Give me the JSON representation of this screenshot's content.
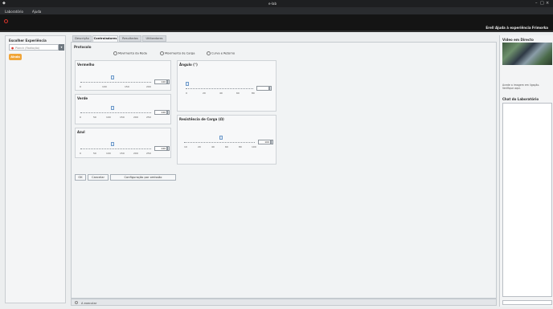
{
  "window": {
    "title": "e-lab"
  },
  "menu": {
    "items": [
      "Laboratório",
      "Ajuda"
    ]
  },
  "brand": {
    "right_title": "Erell Ajuda à experiência Frimorka"
  },
  "left": {
    "header": "Escolher Experiência",
    "selector_value": "Planck (Radiação)",
    "action_button": "Ainda"
  },
  "tabs": [
    "Descrição",
    "Controladores",
    "Resultados",
    "Utilizadores"
  ],
  "content": {
    "protocol_label": "Protocolo",
    "radio_options": [
      "Movimento da Roda",
      "Movimento de Carga",
      "Curva e Retorno"
    ],
    "sliders": [
      {
        "label": "Vermelho",
        "ticks": [
          "0",
          "100",
          "150",
          "200"
        ],
        "value": "140"
      },
      {
        "label": "Verde",
        "ticks": [
          "0",
          "50",
          "100",
          "150",
          "200",
          "250"
        ],
        "value": "140"
      },
      {
        "label": "Azul",
        "ticks": [
          "0",
          "50",
          "100",
          "150",
          "200",
          "250"
        ],
        "value": "140"
      },
      {
        "label": "Ângulo (°)",
        "ticks": [
          "0",
          "20",
          "40",
          "60",
          "80"
        ],
        "value": ""
      },
      {
        "label": "Resistência de Carga (Ω)",
        "ticks": [
          "10",
          "20",
          "40",
          "60",
          "80",
          "100"
        ],
        "value": "100"
      }
    ],
    "buttons": [
      "OK",
      "Cancelar",
      "Configuração por omissão"
    ],
    "status_text": "A executar"
  },
  "right": {
    "video_header": "Vídeo em Directo",
    "video_caption": "Acede a imagem em ligação. Verifique aqui.",
    "log_header": "Chat do Laboratório"
  },
  "colors": {
    "accent": "#f0a53a",
    "logo_red": "#d9342b"
  }
}
